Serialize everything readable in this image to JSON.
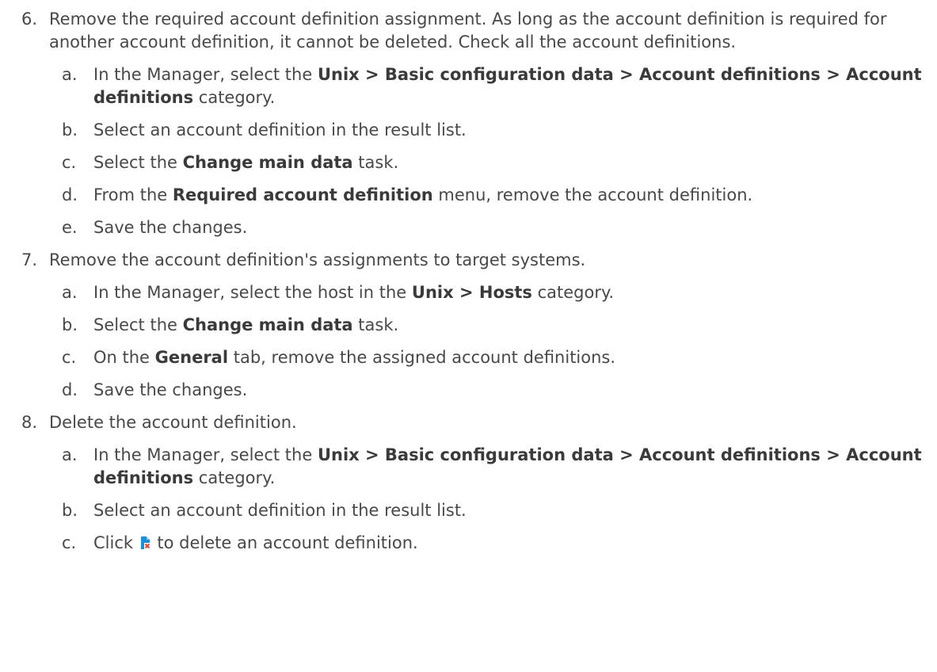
{
  "steps": [
    {
      "num": "6.",
      "text": "Remove the required account definition assignment. As long as the account definition is required for another account definition, it cannot be deleted. Check all the account definitions.",
      "substeps": [
        {
          "letter": "a.",
          "pre": "In the Manager, select the ",
          "bold": "Unix > Basic configuration data > Account definitions > Account definitions",
          "post": " category."
        },
        {
          "letter": "b.",
          "pre": "Select an account definition in the result list.",
          "bold": "",
          "post": ""
        },
        {
          "letter": "c.",
          "pre": "Select the ",
          "bold": "Change main data",
          "post": " task."
        },
        {
          "letter": "d.",
          "pre": "From the ",
          "bold": "Required account definition",
          "post": " menu, remove the account definition."
        },
        {
          "letter": "e.",
          "pre": "Save the changes.",
          "bold": "",
          "post": ""
        }
      ]
    },
    {
      "num": "7.",
      "text": "Remove the account definition's assignments to target systems.",
      "substeps": [
        {
          "letter": "a.",
          "pre": "In the Manager, select the host in the ",
          "bold": "Unix > Hosts",
          "post": " category."
        },
        {
          "letter": "b.",
          "pre": "Select the ",
          "bold": "Change main data",
          "post": " task."
        },
        {
          "letter": "c.",
          "pre": "On the ",
          "bold": "General",
          "post": " tab, remove the assigned account definitions."
        },
        {
          "letter": "d.",
          "pre": "Save the changes.",
          "bold": "",
          "post": ""
        }
      ]
    },
    {
      "num": "8.",
      "text": "Delete the account definition.",
      "substeps": [
        {
          "letter": "a.",
          "pre": "In the Manager, select the ",
          "bold": "Unix > Basic configuration data > Account definitions > Account definitions",
          "post": " category."
        },
        {
          "letter": "b.",
          "pre": "Select an account definition in the result list.",
          "bold": "",
          "post": ""
        },
        {
          "letter": "c.",
          "pre": "Click ",
          "bold": "",
          "post": " to delete an account definition.",
          "icon": "delete-account-definition-icon"
        }
      ]
    }
  ],
  "colors": {
    "text": "#484848",
    "icon_blue": "#1d8fd6",
    "icon_red": "#e2423b"
  }
}
